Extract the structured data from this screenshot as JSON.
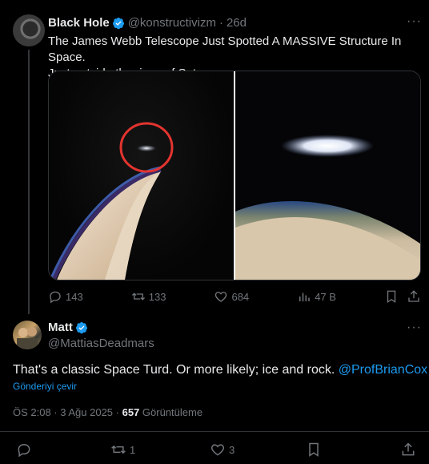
{
  "tweet1": {
    "display_name": "Black Hole",
    "handle": "@konstructivizm",
    "separator": "·",
    "time": "26d",
    "text_line1": "The James Webb Telescope Just Spotted A MASSIVE Structure In Space.",
    "text_line2": "Just outside the rings of Saturn.",
    "metrics": {
      "replies": "143",
      "retweets": "133",
      "likes": "684",
      "views": "47 B"
    }
  },
  "reply": {
    "display_name": "Matt",
    "handle": "@MattiasDeadmars",
    "text": "That's a classic Space Turd. Or more likely; ice and rock. ",
    "mention": "@ProfBrianCox",
    "translate_label": "Gönderiyi çevir",
    "timestamp": "ÖS 2:08 · 3 Ağu 2025 · ",
    "view_count": "657",
    "view_label": " Görüntüleme",
    "metrics": {
      "retweets": "1",
      "likes": "3"
    }
  },
  "colors": {
    "accent": "#1d9bf0",
    "muted": "#71767b",
    "text": "#e7e9ea",
    "circle_annotation": "#e3342f"
  }
}
